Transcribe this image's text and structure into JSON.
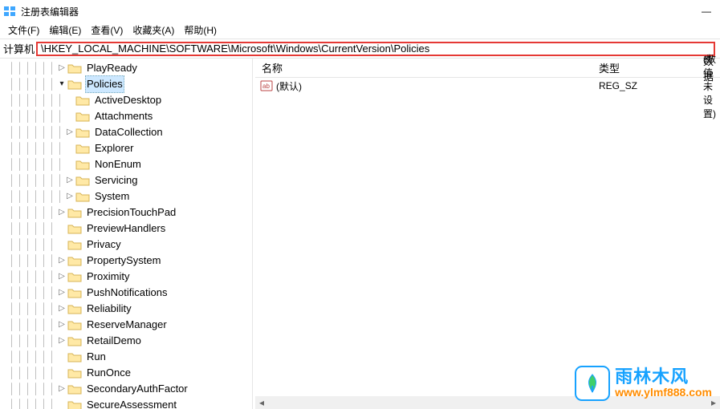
{
  "window": {
    "title": "注册表编辑器",
    "minimize": "—"
  },
  "menu": {
    "file": "文件(F)",
    "edit": "编辑(E)",
    "view": "查看(V)",
    "favorites": "收藏夹(A)",
    "help": "帮助(H)"
  },
  "address": {
    "label": "计算机",
    "path": "\\HKEY_LOCAL_MACHINE\\SOFTWARE\\Microsoft\\Windows\\CurrentVersion\\Policies"
  },
  "tree": {
    "playready": "PlayReady",
    "policies": "Policies",
    "policies_children": {
      "activedesktop": "ActiveDesktop",
      "attachments": "Attachments",
      "datacollection": "DataCollection",
      "explorer": "Explorer",
      "nonenum": "NonEnum",
      "servicing": "Servicing",
      "system": "System"
    },
    "siblings": {
      "precisiontouchpad": "PrecisionTouchPad",
      "previewhandlers": "PreviewHandlers",
      "privacy": "Privacy",
      "propertysystem": "PropertySystem",
      "proximity": "Proximity",
      "pushnotifications": "PushNotifications",
      "reliability": "Reliability",
      "reservemanager": "ReserveManager",
      "retaildemo": "RetailDemo",
      "run": "Run",
      "runonce": "RunOnce",
      "secondaryauthfactor": "SecondaryAuthFactor",
      "secureassessment": "SecureAssessment"
    }
  },
  "list": {
    "columns": {
      "name": "名称",
      "type": "类型",
      "data": "数据"
    },
    "rows": [
      {
        "name": "(默认)",
        "type": "REG_SZ",
        "data": "(数值未设置)"
      }
    ]
  },
  "watermark": {
    "brand": "雨林木风",
    "url": "www.ylmf888.com"
  }
}
